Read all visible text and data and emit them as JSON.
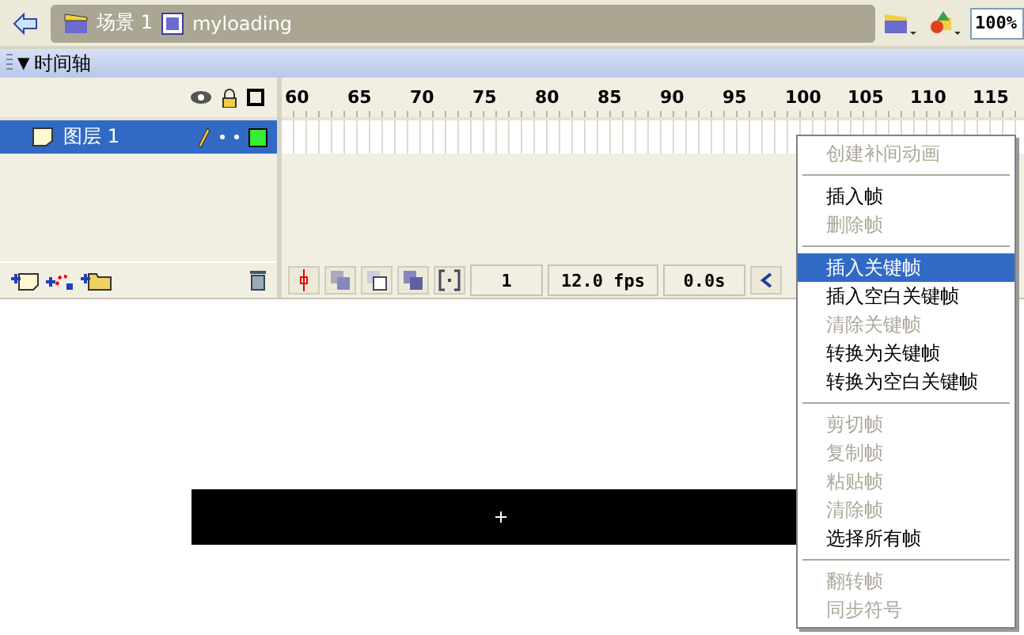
{
  "scene_bar": {
    "scene": "场景 1",
    "symbol": "myloading"
  },
  "zoom": "100%",
  "timeline": {
    "toggle": "▼",
    "title": "时间轴",
    "ruler": [
      "60",
      "65",
      "70",
      "75",
      "80",
      "85",
      "90",
      "95",
      "100",
      "105",
      "110",
      "115"
    ],
    "layers": [
      {
        "name": "图层 1",
        "selected": true,
        "color": "#33ee33"
      }
    ],
    "status": {
      "frame": "1",
      "fps": "12.0 fps",
      "time": "0.0s"
    }
  },
  "context_menu": [
    {
      "kind": "item",
      "label": "创建补间动画",
      "disabled": true,
      "selected": false
    },
    {
      "kind": "separator"
    },
    {
      "kind": "item",
      "label": "插入帧",
      "disabled": false,
      "selected": false
    },
    {
      "kind": "item",
      "label": "删除帧",
      "disabled": true,
      "selected": false
    },
    {
      "kind": "separator"
    },
    {
      "kind": "item",
      "label": "插入关键帧",
      "disabled": false,
      "selected": true
    },
    {
      "kind": "item",
      "label": "插入空白关键帧",
      "disabled": false,
      "selected": false
    },
    {
      "kind": "item",
      "label": "清除关键帧",
      "disabled": true,
      "selected": false
    },
    {
      "kind": "item",
      "label": "转换为关键帧",
      "disabled": false,
      "selected": false
    },
    {
      "kind": "item",
      "label": "转换为空白关键帧",
      "disabled": false,
      "selected": false
    },
    {
      "kind": "separator"
    },
    {
      "kind": "item",
      "label": "剪切帧",
      "disabled": true,
      "selected": false
    },
    {
      "kind": "item",
      "label": "复制帧",
      "disabled": true,
      "selected": false
    },
    {
      "kind": "item",
      "label": "粘贴帧",
      "disabled": true,
      "selected": false
    },
    {
      "kind": "item",
      "label": "清除帧",
      "disabled": true,
      "selected": false
    },
    {
      "kind": "item",
      "label": "选择所有帧",
      "disabled": false,
      "selected": false
    },
    {
      "kind": "separator"
    },
    {
      "kind": "item",
      "label": "翻转帧",
      "disabled": true,
      "selected": false
    },
    {
      "kind": "item",
      "label": "同步符号",
      "disabled": true,
      "selected": false
    }
  ]
}
